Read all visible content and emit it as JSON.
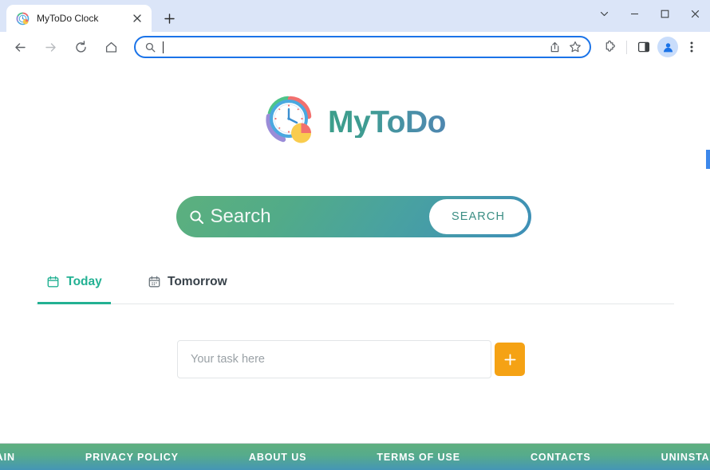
{
  "browser": {
    "tab": {
      "title": "MyToDo Clock",
      "favicon_name": "mytodo-clock-favicon",
      "close_label": "×"
    },
    "newtab_label": "+",
    "window_controls": {
      "tab_search": "tab-search-chevron",
      "minimize": "minimize",
      "maximize": "maximize",
      "close": "close"
    },
    "toolbar": {
      "back": "back-arrow",
      "forward": "forward-arrow",
      "reload": "reload",
      "home": "home",
      "omnibox": {
        "value": "",
        "placeholder": "",
        "search_icon": "search-icon",
        "share_icon": "share-icon",
        "bookmark_icon": "star-icon"
      },
      "extensions": "puzzle-icon",
      "side_panel": "side-panel-icon",
      "profile": "profile-avatar",
      "menu": "three-dot-menu"
    }
  },
  "page": {
    "logo": {
      "mark_name": "mytodo-clock-logo",
      "text": "MyToDo"
    },
    "search": {
      "placeholder": "Search",
      "button_label": "SEARCH",
      "icon": "search-icon",
      "gradient_from": "#5cb07e",
      "gradient_to": "#3e8fb8"
    },
    "day_tabs": [
      {
        "label": "Today",
        "icon": "calendar-icon",
        "active": true
      },
      {
        "label": "Tomorrow",
        "icon": "calendar-icon",
        "active": false
      }
    ],
    "task": {
      "value": "",
      "placeholder": "Your task here",
      "add_label": "+",
      "add_color": "#f5a214"
    },
    "footer_links": [
      "MAIN",
      "PRIVACY POLICY",
      "ABOUT US",
      "TERMS OF USE",
      "CONTACTS",
      "UNINSTALL"
    ],
    "accent_color": "#23b193"
  }
}
